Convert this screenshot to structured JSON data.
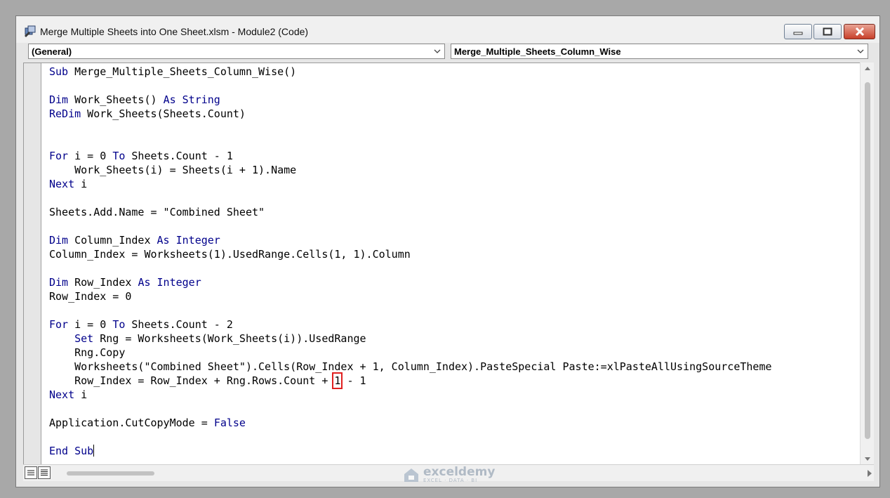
{
  "window": {
    "title": "Merge Multiple Sheets into One Sheet.xlsm - Module2 (Code)"
  },
  "object_combo": {
    "value": "(General)"
  },
  "procedure_combo": {
    "value": "Merge_Multiple_Sheets_Column_Wise"
  },
  "code_lines": [
    [
      {
        "t": "Sub",
        "k": 1
      },
      {
        "t": " Merge_Multiple_Sheets_Column_Wise()"
      }
    ],
    [],
    [
      {
        "t": "Dim",
        "k": 1
      },
      {
        "t": " Work_Sheets() "
      },
      {
        "t": "As",
        "k": 1
      },
      {
        "t": " "
      },
      {
        "t": "String",
        "k": 1
      }
    ],
    [
      {
        "t": "ReDim",
        "k": 1
      },
      {
        "t": " Work_Sheets(Sheets.Count)"
      }
    ],
    [],
    [],
    [
      {
        "t": "For",
        "k": 1
      },
      {
        "t": " i = 0 "
      },
      {
        "t": "To",
        "k": 1
      },
      {
        "t": " Sheets.Count - 1"
      }
    ],
    [
      {
        "t": "    Work_Sheets(i) = Sheets(i + 1).Name"
      }
    ],
    [
      {
        "t": "Next",
        "k": 1
      },
      {
        "t": " i"
      }
    ],
    [],
    [
      {
        "t": "Sheets.Add.Name = \"Combined Sheet\""
      }
    ],
    [],
    [
      {
        "t": "Dim",
        "k": 1
      },
      {
        "t": " Column_Index "
      },
      {
        "t": "As",
        "k": 1
      },
      {
        "t": " "
      },
      {
        "t": "Integer",
        "k": 1
      }
    ],
    [
      {
        "t": "Column_Index = Worksheets(1).UsedRange.Cells(1, 1).Column"
      }
    ],
    [],
    [
      {
        "t": "Dim",
        "k": 1
      },
      {
        "t": " Row_Index "
      },
      {
        "t": "As",
        "k": 1
      },
      {
        "t": " "
      },
      {
        "t": "Integer",
        "k": 1
      }
    ],
    [
      {
        "t": "Row_Index = 0"
      }
    ],
    [],
    [
      {
        "t": "For",
        "k": 1
      },
      {
        "t": " i = 0 "
      },
      {
        "t": "To",
        "k": 1
      },
      {
        "t": " Sheets.Count - 2"
      }
    ],
    [
      {
        "t": "    "
      },
      {
        "t": "Set",
        "k": 1
      },
      {
        "t": " Rng = Worksheets(Work_Sheets(i)).UsedRange"
      }
    ],
    [
      {
        "t": "    Rng.Copy"
      }
    ],
    [
      {
        "t": "    Worksheets(\"Combined Sheet\").Cells(Row_Index + 1, Column_Index).PasteSpecial Paste:=xlPasteAllUsingSourceTheme"
      }
    ],
    [
      {
        "t": "    Row_Index = Row_Index + Rng.Rows.Count + "
      },
      {
        "t": "1",
        "h": 1
      },
      {
        "t": " - 1"
      }
    ],
    [
      {
        "t": "Next",
        "k": 1
      },
      {
        "t": " i"
      }
    ],
    [],
    [
      {
        "t": "Application.CutCopyMode = "
      },
      {
        "t": "False",
        "k": 1
      }
    ],
    [],
    [
      {
        "t": "End Sub",
        "k": 1,
        "caret": 1
      }
    ]
  ],
  "watermark": {
    "brand": "exceldemy",
    "tagline": "EXCEL · DATA · BI"
  },
  "colors": {
    "keyword": "#00008b",
    "highlight_box": "#e02020"
  }
}
